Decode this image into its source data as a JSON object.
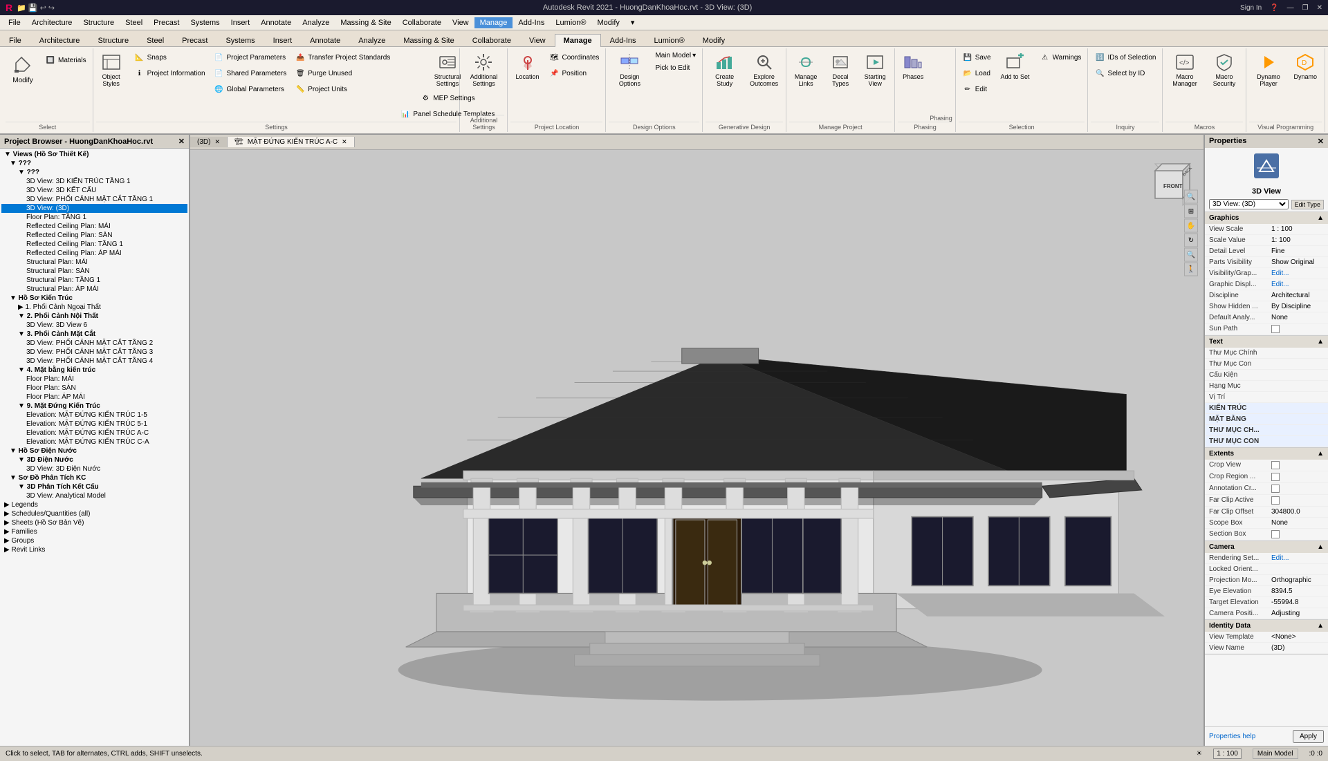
{
  "titleBar": {
    "left": "🔴 🟡 📁 💾 🔙 ↩ ↪",
    "center": "Autodesk Revit 2021 - HuongDanKhoaHoc.rvt - 3D View: (3D)",
    "signIn": "Sign In",
    "help": "?",
    "minimize": "—",
    "restore": "❐",
    "close": "✕"
  },
  "menuBar": {
    "items": [
      "File",
      "Architecture",
      "Structure",
      "Steel",
      "Precast",
      "Systems",
      "Insert",
      "Annotate",
      "Analyze",
      "Massing & Site",
      "Collaborate",
      "View",
      "Manage",
      "Add-Ins",
      "Lumion®",
      "Modify",
      "▾"
    ]
  },
  "ribbon": {
    "activeTab": "Manage",
    "tabs": [
      "File",
      "Architecture",
      "Structure",
      "Steel",
      "Precast",
      "Systems",
      "Insert",
      "Annotate",
      "Analyze",
      "Massing & Site",
      "Collaborate",
      "View",
      "Manage",
      "Add-Ins",
      "Lumion®",
      "Modify"
    ],
    "groups": [
      {
        "name": "Select",
        "label": "Select",
        "buttons": [
          {
            "id": "modify",
            "label": "Modify",
            "type": "large",
            "icon": "✏️"
          },
          {
            "id": "materials",
            "label": "Materials",
            "type": "small",
            "icon": "🔲"
          }
        ]
      },
      {
        "name": "Settings",
        "label": "Settings",
        "buttons": [
          {
            "id": "object-styles",
            "label": "Object Styles",
            "type": "large",
            "icon": "📋"
          },
          {
            "id": "snaps",
            "label": "Snaps",
            "type": "small",
            "icon": "🔲"
          },
          {
            "id": "project-info",
            "label": "Project Information",
            "type": "small",
            "icon": "ℹ"
          },
          {
            "id": "project-params",
            "label": "Project Parameters",
            "type": "small",
            "icon": "📄"
          },
          {
            "id": "shared-params",
            "label": "Shared Parameters",
            "type": "small",
            "icon": "📄"
          },
          {
            "id": "global-params",
            "label": "Global Parameters",
            "type": "small",
            "icon": "🌐"
          },
          {
            "id": "transfer-standards",
            "label": "Transfer Project Standards",
            "type": "small",
            "icon": "📤"
          },
          {
            "id": "purge",
            "label": "Purge Unused",
            "type": "small",
            "icon": "🗑"
          },
          {
            "id": "project-units",
            "label": "Project Units",
            "type": "small",
            "icon": "📏"
          },
          {
            "id": "structural-settings",
            "label": "Structural Settings",
            "type": "large",
            "icon": "🔩"
          },
          {
            "id": "mep-settings",
            "label": "MEP Settings",
            "type": "small",
            "icon": "⚙"
          },
          {
            "id": "panel-schedule",
            "label": "Panel Schedule Templates",
            "type": "small",
            "icon": "📊"
          }
        ]
      },
      {
        "name": "Additional Settings",
        "label": "Additional Settings",
        "buttons": [
          {
            "id": "additional-settings",
            "label": "Additional Settings",
            "type": "large",
            "icon": "⚙"
          }
        ]
      },
      {
        "name": "Project Location",
        "label": "Project Location",
        "buttons": [
          {
            "id": "location",
            "label": "Location",
            "type": "large",
            "icon": "📍"
          },
          {
            "id": "coordinates",
            "label": "Coordinates",
            "type": "small",
            "icon": "🗺"
          },
          {
            "id": "position",
            "label": "Position",
            "type": "small",
            "icon": "📌"
          }
        ]
      },
      {
        "name": "Design Options",
        "label": "Design Options",
        "buttons": [
          {
            "id": "design-options",
            "label": "Design Options",
            "type": "large",
            "icon": "🔀"
          },
          {
            "id": "main-model",
            "label": "Main Model",
            "type": "small",
            "icon": "🏠"
          },
          {
            "id": "pick-to-edit",
            "label": "Pick to Edit",
            "type": "small",
            "icon": "✏"
          }
        ]
      },
      {
        "name": "Generative Design",
        "label": "Generative Design",
        "buttons": [
          {
            "id": "create-study",
            "label": "Create Study",
            "type": "large",
            "icon": "📈"
          },
          {
            "id": "explore-outcomes",
            "label": "Explore Outcomes",
            "type": "large",
            "icon": "🔍"
          }
        ]
      },
      {
        "name": "Manage Project",
        "label": "Manage Project",
        "buttons": [
          {
            "id": "manage-links",
            "label": "Manage Links",
            "type": "large",
            "icon": "🔗"
          },
          {
            "id": "decal-types",
            "label": "Decal Types",
            "type": "large",
            "icon": "🖼"
          },
          {
            "id": "starting-view",
            "label": "Starting View",
            "type": "large",
            "icon": "▶"
          }
        ]
      },
      {
        "name": "Phasing",
        "label": "Phasing",
        "buttons": [
          {
            "id": "phases",
            "label": "Phases",
            "type": "large",
            "icon": "📅"
          }
        ]
      },
      {
        "name": "Selection",
        "label": "Selection",
        "buttons": [
          {
            "id": "save-selection",
            "label": "Save",
            "type": "small",
            "icon": "💾"
          },
          {
            "id": "load-selection",
            "label": "Load",
            "type": "small",
            "icon": "📂"
          },
          {
            "id": "edit-selection",
            "label": "Edit",
            "type": "small",
            "icon": "✏"
          },
          {
            "id": "add-to-set",
            "label": "Add to Set",
            "type": "large",
            "icon": "➕"
          },
          {
            "id": "warnings",
            "label": "Warnings",
            "type": "small",
            "icon": "⚠"
          }
        ]
      },
      {
        "name": "Inquiry",
        "label": "Inquiry",
        "buttons": [
          {
            "id": "ids-of-selection",
            "label": "IDs of Selection",
            "type": "small",
            "icon": "🔢"
          },
          {
            "id": "select-by-id",
            "label": "Select by ID",
            "type": "small",
            "icon": "🔍"
          }
        ]
      },
      {
        "name": "Macros",
        "label": "Macros",
        "buttons": [
          {
            "id": "macro-manager",
            "label": "Macro Manager",
            "type": "large",
            "icon": "⚙"
          },
          {
            "id": "macro-security",
            "label": "Macro Security",
            "type": "large",
            "icon": "🔒"
          }
        ]
      },
      {
        "name": "Visual Programming",
        "label": "Visual Programming",
        "buttons": [
          {
            "id": "dynamo-player",
            "label": "Dynamo Player",
            "type": "large",
            "icon": "▶"
          },
          {
            "id": "dynamo",
            "label": "Dynamo",
            "type": "large",
            "icon": "⬡"
          }
        ]
      }
    ]
  },
  "projectBrowser": {
    "title": "Project Browser - HuongDanKhoaHoc.rvt",
    "tree": [
      {
        "level": 0,
        "label": "Views (Hồ Sơ Thiết Kế)",
        "expanded": true,
        "icon": "▼"
      },
      {
        "level": 1,
        "label": "???",
        "expanded": true,
        "icon": "▼"
      },
      {
        "level": 2,
        "label": "???",
        "expanded": true,
        "icon": "▼"
      },
      {
        "level": 3,
        "label": "3D View: 3D KIẾN TRÚC TẦNG 1",
        "expanded": false,
        "icon": " "
      },
      {
        "level": 3,
        "label": "3D View: 3D KẾT CẤU",
        "expanded": false,
        "icon": " "
      },
      {
        "level": 3,
        "label": "3D View: PHỐI CẢNH MẶT CẮT TẦNG 1",
        "expanded": false,
        "icon": " "
      },
      {
        "level": 3,
        "label": "3D View: (3D)",
        "expanded": false,
        "icon": " ",
        "active": true
      },
      {
        "level": 3,
        "label": "Floor Plan: TẦNG 1",
        "expanded": false,
        "icon": " "
      },
      {
        "level": 3,
        "label": "Reflected Ceiling Plan: MÁI",
        "expanded": false,
        "icon": " "
      },
      {
        "level": 3,
        "label": "Reflected Ceiling Plan: SÀN",
        "expanded": false,
        "icon": " "
      },
      {
        "level": 3,
        "label": "Reflected Ceiling Plan: TẦNG 1",
        "expanded": false,
        "icon": " "
      },
      {
        "level": 3,
        "label": "Reflected Ceiling Plan: ÁP MÁI",
        "expanded": false,
        "icon": " "
      },
      {
        "level": 3,
        "label": "Structural Plan: MÁI",
        "expanded": false,
        "icon": " "
      },
      {
        "level": 3,
        "label": "Structural Plan: SÀN",
        "expanded": false,
        "icon": " "
      },
      {
        "level": 3,
        "label": "Structural Plan: TẦNG 1",
        "expanded": false,
        "icon": " "
      },
      {
        "level": 3,
        "label": "Structural Plan: ÁP MÁI",
        "expanded": false,
        "icon": " "
      },
      {
        "level": 1,
        "label": "Hồ Sơ Kiến Trúc",
        "expanded": true,
        "icon": "▼"
      },
      {
        "level": 2,
        "label": "1. Phối Cảnh Ngoại Thất",
        "expanded": false,
        "icon": "▶"
      },
      {
        "level": 2,
        "label": "2. Phối Cảnh Nội Thất",
        "expanded": true,
        "icon": "▼"
      },
      {
        "level": 3,
        "label": "3D View: 3D View 6",
        "expanded": false,
        "icon": " "
      },
      {
        "level": 2,
        "label": "3. Phối Cảnh Mặt Cắt",
        "expanded": true,
        "icon": "▼"
      },
      {
        "level": 3,
        "label": "3D View: PHỐI CẢNH MẶT CẮT TẦNG 2",
        "expanded": false,
        "icon": " "
      },
      {
        "level": 3,
        "label": "3D View: PHỐI CẢNH MẶT CẮT TẦNG 3",
        "expanded": false,
        "icon": " "
      },
      {
        "level": 3,
        "label": "3D View: PHỐI CẢNH MẶT CẮT TẦNG 4",
        "expanded": false,
        "icon": " "
      },
      {
        "level": 2,
        "label": "4. Mặt bằng kiến trúc",
        "expanded": true,
        "icon": "▼"
      },
      {
        "level": 3,
        "label": "Floor Plan: MÁI",
        "expanded": false,
        "icon": " "
      },
      {
        "level": 3,
        "label": "Floor Plan: SÀN",
        "expanded": false,
        "icon": " "
      },
      {
        "level": 3,
        "label": "Floor Plan: ÁP MÁI",
        "expanded": false,
        "icon": " "
      },
      {
        "level": 2,
        "label": "9. Mặt Đứng Kiến Trúc",
        "expanded": true,
        "icon": "▼"
      },
      {
        "level": 3,
        "label": "Elevation: MẶT ĐỨNG KIẾN TRÚC 1-5",
        "expanded": false,
        "icon": " "
      },
      {
        "level": 3,
        "label": "Elevation: MẶT ĐỨNG KIẾN TRÚC 5-1",
        "expanded": false,
        "icon": " "
      },
      {
        "level": 3,
        "label": "Elevation: MẶT ĐỨNG KIẾN TRÚC A-C",
        "expanded": false,
        "icon": " "
      },
      {
        "level": 3,
        "label": "Elevation: MẶT ĐỨNG KIẾN TRÚC C-A",
        "expanded": false,
        "icon": " "
      },
      {
        "level": 1,
        "label": "Hồ Sơ Điện Nước",
        "expanded": true,
        "icon": "▼"
      },
      {
        "level": 2,
        "label": "3D Điện Nước",
        "expanded": true,
        "icon": "▼"
      },
      {
        "level": 3,
        "label": "3D View: 3D Điện Nước",
        "expanded": false,
        "icon": " "
      },
      {
        "level": 1,
        "label": "Sơ Đồ Phân Tích KC",
        "expanded": true,
        "icon": "▼"
      },
      {
        "level": 2,
        "label": "3D Phân Tích Kết Cấu",
        "expanded": true,
        "icon": "▼"
      },
      {
        "level": 3,
        "label": "3D View: Analytical Model",
        "expanded": false,
        "icon": " "
      },
      {
        "level": 0,
        "label": "Legends",
        "expanded": false,
        "icon": "▶"
      },
      {
        "level": 0,
        "label": "Schedules/Quantities (all)",
        "expanded": false,
        "icon": "▶"
      },
      {
        "level": 0,
        "label": "Sheets (Hồ Sơ Bản Vẽ)",
        "expanded": false,
        "icon": "▶"
      },
      {
        "level": 0,
        "label": "Families",
        "expanded": false,
        "icon": "▶"
      },
      {
        "level": 0,
        "label": "Groups",
        "expanded": false,
        "icon": "▶"
      },
      {
        "level": 0,
        "label": "Revit Links",
        "expanded": false,
        "icon": "▶"
      }
    ]
  },
  "viewTabs": [
    {
      "label": "(3D)",
      "id": "3d-view",
      "active": false
    },
    {
      "label": "MẶT ĐỨNG KIẾN TRÚC A-C",
      "id": "elevation-view",
      "active": true
    }
  ],
  "viewport": {
    "scale": "1 : 100",
    "viewName": "3D View",
    "house": {
      "description": "3D Isometric view of Vietnamese traditional house"
    }
  },
  "statusBar": {
    "message": "Click to select, TAB for alternates, CTRL adds, SHIFT unselects.",
    "scale": "1 : 100",
    "xcoord": "0",
    "ycoord": "0",
    "activeModel": "Main Model"
  },
  "properties": {
    "title": "Properties",
    "viewName": "3D View",
    "viewDropdown": "3D View: (3D)",
    "editType": "Edit Type",
    "sections": [
      {
        "name": "Graphics",
        "label": "Graphics",
        "rows": [
          {
            "label": "View Scale",
            "value": "1 : 100"
          },
          {
            "label": "Scale Value",
            "value": "1:",
            "value2": "100"
          },
          {
            "label": "Detail Level",
            "value": "Fine"
          },
          {
            "label": "Parts Visibility",
            "value": "Show Original"
          },
          {
            "label": "Visibility/Grap...",
            "value": "Edit..."
          },
          {
            "label": "Graphic Displ...",
            "value": "Edit..."
          },
          {
            "label": "Discipline",
            "value": "Architectural"
          },
          {
            "label": "Show Hidden ...",
            "value": "By Discipline"
          },
          {
            "label": "Default Analy...",
            "value": "None"
          },
          {
            "label": "Sun Path",
            "value": "checkbox",
            "checked": false
          }
        ]
      },
      {
        "name": "Text",
        "label": "Text",
        "rows": [
          {
            "label": "Thư Mục Chính",
            "value": ""
          },
          {
            "label": "Thư Mục Con",
            "value": ""
          },
          {
            "label": "Cấu Kiện",
            "value": ""
          },
          {
            "label": "Hạng Mục",
            "value": ""
          },
          {
            "label": "Vị Trí",
            "value": ""
          },
          {
            "label": "KIẾN TRÚC",
            "value": ""
          },
          {
            "label": "MẶT BẰNG",
            "value": ""
          },
          {
            "label": "THƯ MỤC CH...",
            "value": ""
          },
          {
            "label": "THƯ MỤC CON",
            "value": ""
          }
        ]
      },
      {
        "name": "Extents",
        "label": "Extents",
        "rows": [
          {
            "label": "Crop View",
            "value": "checkbox",
            "checked": false
          },
          {
            "label": "Crop Region ...",
            "value": "checkbox",
            "checked": false
          },
          {
            "label": "Annotation Cr...",
            "value": "checkbox",
            "checked": false
          },
          {
            "label": "Far Clip Active",
            "value": "checkbox",
            "checked": false
          },
          {
            "label": "Far Clip Offset",
            "value": "304800.0"
          },
          {
            "label": "Scope Box",
            "value": "None"
          },
          {
            "label": "Section Box",
            "value": "checkbox",
            "checked": false
          }
        ]
      },
      {
        "name": "Camera",
        "label": "Camera",
        "rows": [
          {
            "label": "Rendering Set...",
            "value": "Edit..."
          },
          {
            "label": "Locked Orient...",
            "value": ""
          },
          {
            "label": "Projection Mo...",
            "value": "Orthographic"
          },
          {
            "label": "Eye Elevation",
            "value": "8394.5"
          },
          {
            "label": "Target Elevation",
            "value": "-55994.8"
          },
          {
            "label": "Camera Positi...",
            "value": "Adjusting"
          }
        ]
      },
      {
        "name": "Identity Data",
        "label": "Identity Data",
        "rows": [
          {
            "label": "View Template",
            "value": "<None>"
          },
          {
            "label": "View Name",
            "value": "(3D)"
          }
        ]
      }
    ],
    "propertiesHelp": "Properties help",
    "applyBtn": "Apply"
  }
}
